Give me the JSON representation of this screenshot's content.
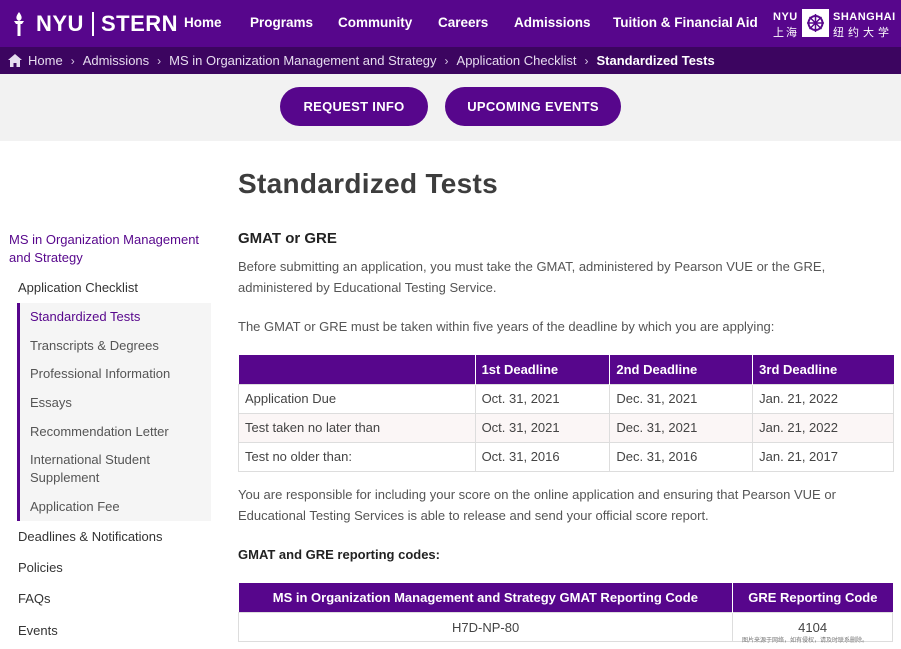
{
  "brand": {
    "nyu": "NYU",
    "stern": "STERN"
  },
  "nav": {
    "items": [
      "Home",
      "Programs",
      "Community",
      "Careers",
      "Admissions",
      "Tuition & Financial Aid"
    ],
    "shanghai": {
      "nyu": "NYU",
      "word": "SHANGHAI",
      "cn1": "上海",
      "cn2": "纽约大学"
    }
  },
  "breadcrumb": {
    "items": [
      "Home",
      "Admissions",
      "MS in Organization Management and Strategy",
      "Application Checklist"
    ],
    "current": "Standardized Tests"
  },
  "cta": {
    "request_info": "REQUEST INFO",
    "upcoming_events": "UPCOMING EVENTS"
  },
  "sidebar": {
    "program": "MS in Organization Management and Strategy",
    "checklist": "Application Checklist",
    "sub_items": [
      "Standardized Tests",
      "Transcripts & Degrees",
      "Professional Information",
      "Essays",
      "Recommendation Letter",
      "International Student Supplement",
      "Application Fee"
    ],
    "active_index": 0,
    "items": [
      "Deadlines & Notifications",
      "Policies",
      "FAQs",
      "Events"
    ]
  },
  "main": {
    "title": "Standardized Tests",
    "section_heading": "GMAT or GRE",
    "para1": "Before submitting an application, you must take the GMAT, administered by Pearson VUE or the GRE, administered by Educational Testing Service.",
    "para2": "The GMAT or GRE must be taken within five years of the deadline by which you are applying:",
    "deadline_table": {
      "headers": [
        "",
        "1st Deadline",
        "2nd Deadline",
        "3rd Deadline"
      ],
      "rows": [
        [
          "Application Due",
          "Oct. 31, 2021",
          "Dec. 31, 2021",
          "Jan. 21, 2022"
        ],
        [
          "Test taken no later than",
          "Oct. 31, 2021",
          "Dec. 31, 2021",
          "Jan. 21, 2022"
        ],
        [
          "Test no older than:",
          "Oct. 31, 2016",
          "Dec. 31, 2016",
          "Jan. 21, 2017"
        ]
      ]
    },
    "para3": "You are responsible for including your score on the online application and ensuring that Pearson VUE or Educational Testing Services is able to release and send your official score report.",
    "codes_heading": "GMAT and GRE reporting codes:",
    "codes_table": {
      "headers": [
        "MS in Organization Management and Strategy GMAT Reporting Code",
        "GRE Reporting Code"
      ],
      "row": [
        "H7D-NP-80",
        "4104"
      ]
    },
    "watermark_note": "图片来源于网络，如有侵权，请及时联系删除。"
  },
  "colors": {
    "brand_purple": "#57068c",
    "crumb_purple": "#3c0560"
  }
}
